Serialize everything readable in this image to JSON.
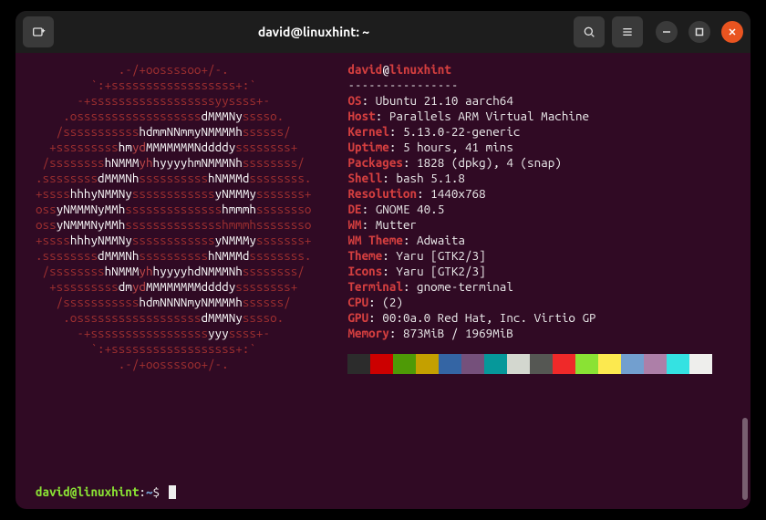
{
  "window": {
    "title": "david@linuxhint: ~"
  },
  "neofetch": {
    "user": "david",
    "host": "linuxhint",
    "sep": "----------------",
    "fields": [
      {
        "k": "OS",
        "v": "Ubuntu 21.10 aarch64"
      },
      {
        "k": "Host",
        "v": "Parallels ARM Virtual Machine"
      },
      {
        "k": "Kernel",
        "v": "5.13.0-22-generic"
      },
      {
        "k": "Uptime",
        "v": "5 hours, 41 mins"
      },
      {
        "k": "Packages",
        "v": "1828 (dpkg), 4 (snap)"
      },
      {
        "k": "Shell",
        "v": "bash 5.1.8"
      },
      {
        "k": "Resolution",
        "v": "1440x768"
      },
      {
        "k": "DE",
        "v": "GNOME 40.5"
      },
      {
        "k": "WM",
        "v": "Mutter"
      },
      {
        "k": "WM Theme",
        "v": "Adwaita"
      },
      {
        "k": "Theme",
        "v": "Yaru [GTK2/3]"
      },
      {
        "k": "Icons",
        "v": "Yaru [GTK2/3]"
      },
      {
        "k": "Terminal",
        "v": "gnome-terminal"
      },
      {
        "k": "CPU",
        "v": "(2)"
      },
      {
        "k": "GPU",
        "v": "00:0a.0 Red Hat, Inc. Virtio GP"
      },
      {
        "k": "Memory",
        "v": "873MiB / 1969MiB"
      }
    ],
    "swatches": [
      "#2c2c2c",
      "#cc0000",
      "#4e9a06",
      "#c4a000",
      "#3465a4",
      "#75507b",
      "#06989a",
      "#d3d7cf",
      "#555753",
      "#ef2929",
      "#8ae234",
      "#fce94f",
      "#729fcf",
      "#ad7fa8",
      "#34e2e2",
      "#eeeeec"
    ]
  },
  "ascii": [
    [
      {
        "c": "r",
        "t": "            .-/+oossssoo+/-."
      }
    ],
    [
      {
        "c": "r",
        "t": "        `:+ssssssssssssssssss+:`"
      }
    ],
    [
      {
        "c": "r",
        "t": "      -+ssssssssssssssssssyyssss+-"
      }
    ],
    [
      {
        "c": "r",
        "t": "    .ossssssssssssssssss"
      },
      {
        "c": "w",
        "t": "dMMMNy"
      },
      {
        "c": "r",
        "t": "sssso."
      }
    ],
    [
      {
        "c": "r",
        "t": "   /sssssssssss"
      },
      {
        "c": "w",
        "t": "hdmmNNmmyNMMMMh"
      },
      {
        "c": "r",
        "t": "ssssss/"
      }
    ],
    [
      {
        "c": "r",
        "t": "  +sssssssss"
      },
      {
        "c": "w",
        "t": "hm"
      },
      {
        "c": "y",
        "t": "yd"
      },
      {
        "c": "w",
        "t": "MMMMMMMNddddy"
      },
      {
        "c": "r",
        "t": "ssssssss+"
      }
    ],
    [
      {
        "c": "r",
        "t": " /ssssssss"
      },
      {
        "c": "w",
        "t": "hNMMM"
      },
      {
        "c": "y",
        "t": "yh"
      },
      {
        "c": "w",
        "t": "hyyyyhmNMMMNh"
      },
      {
        "c": "r",
        "t": "ssssssss/"
      }
    ],
    [
      {
        "c": "r",
        "t": ".ssssssss"
      },
      {
        "c": "w",
        "t": "dMMMNh"
      },
      {
        "c": "r",
        "t": "ssssssssss"
      },
      {
        "c": "w",
        "t": "hNMMMd"
      },
      {
        "c": "r",
        "t": "ssssssss."
      }
    ],
    [
      {
        "c": "r",
        "t": "+ssss"
      },
      {
        "c": "w",
        "t": "hhhyNMMNy"
      },
      {
        "c": "r",
        "t": "ssssssssssss"
      },
      {
        "c": "w",
        "t": "yNMMMy"
      },
      {
        "c": "r",
        "t": "sssssss+"
      }
    ],
    [
      {
        "c": "r",
        "t": "oss"
      },
      {
        "c": "w",
        "t": "yNMMMNyMMh"
      },
      {
        "c": "r",
        "t": "ssssssssssssss"
      },
      {
        "c": "w",
        "t": "hmmmh"
      },
      {
        "c": "r",
        "t": "ssssssso"
      }
    ],
    [
      {
        "c": "r",
        "t": "oss"
      },
      {
        "c": "w",
        "t": "yNMMMNyMMh"
      },
      {
        "c": "r",
        "t": "sssssssssssssshmmmhssssssso"
      }
    ],
    [
      {
        "c": "r",
        "t": "+ssss"
      },
      {
        "c": "w",
        "t": "hhhyNMMNy"
      },
      {
        "c": "r",
        "t": "ssssssssssss"
      },
      {
        "c": "w",
        "t": "yNMMMy"
      },
      {
        "c": "r",
        "t": "sssssss+"
      }
    ],
    [
      {
        "c": "r",
        "t": ".ssssssss"
      },
      {
        "c": "w",
        "t": "dMMMNh"
      },
      {
        "c": "r",
        "t": "ssssssssss"
      },
      {
        "c": "w",
        "t": "hNMMMd"
      },
      {
        "c": "r",
        "t": "ssssssss."
      }
    ],
    [
      {
        "c": "r",
        "t": " /ssssssss"
      },
      {
        "c": "w",
        "t": "hNMMM"
      },
      {
        "c": "y",
        "t": "yh"
      },
      {
        "c": "w",
        "t": "hyyyyhdNMMMNh"
      },
      {
        "c": "r",
        "t": "ssssssss/"
      }
    ],
    [
      {
        "c": "r",
        "t": "  +sssssssss"
      },
      {
        "c": "w",
        "t": "dm"
      },
      {
        "c": "y",
        "t": "yd"
      },
      {
        "c": "w",
        "t": "MMMMMMMMddddy"
      },
      {
        "c": "r",
        "t": "ssssssss+"
      }
    ],
    [
      {
        "c": "r",
        "t": "   /sssssssssss"
      },
      {
        "c": "w",
        "t": "hdmNNNNmyNMMMMh"
      },
      {
        "c": "r",
        "t": "ssssss/"
      }
    ],
    [
      {
        "c": "r",
        "t": "    .ossssssssssssssssss"
      },
      {
        "c": "w",
        "t": "dMMMNy"
      },
      {
        "c": "r",
        "t": "sssso."
      }
    ],
    [
      {
        "c": "r",
        "t": "      -+sssssssssssssssss"
      },
      {
        "c": "w",
        "t": "yyy"
      },
      {
        "c": "r",
        "t": "ssss+-"
      }
    ],
    [
      {
        "c": "r",
        "t": "        `:+ssssssssssssssssss+:`"
      }
    ],
    [
      {
        "c": "r",
        "t": "            .-/+oossssoo+/-."
      }
    ]
  ],
  "prompt": {
    "user": "david@linuxhint",
    "colon": ":",
    "path": "~",
    "sym": "$ "
  }
}
